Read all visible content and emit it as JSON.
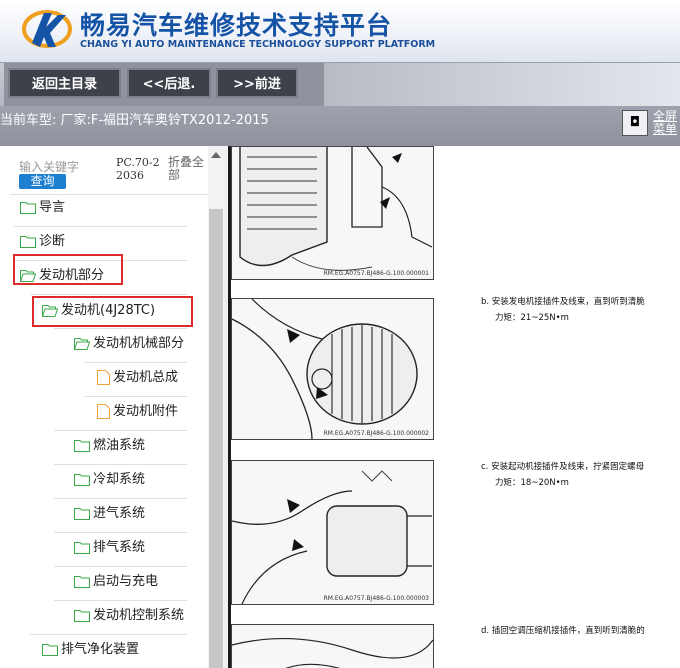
{
  "header": {
    "title_cn": "畅易汽车维修技术支持平台",
    "title_en": "CHANG YI AUTO MAINTENANCE TECHNOLOGY SUPPORT PLATFORM",
    "logo_icon": "cy-logo-icon"
  },
  "toolbar": {
    "home_label": "返回主目录",
    "back_label": "<<后退.",
    "forward_label": ">>前进"
  },
  "vehicle_bar": {
    "text": "当前车型:  厂家:F-福田汽车奥铃TX2012-2015",
    "fullscreen_label_1": "全屏",
    "fullscreen_label_2": "菜单",
    "fullscreen_icon": "fullscreen-icon"
  },
  "sidebar": {
    "search_placeholder": "输入关键字",
    "search_button": "查询",
    "model_code": "PC.70-22036",
    "collapse_label": "折叠全部",
    "items": [
      {
        "label": "导言",
        "icon": "folder-icon"
      },
      {
        "label": "诊断",
        "icon": "folder-icon"
      },
      {
        "label": "发动机部分",
        "icon": "folder-open-icon",
        "highlighted": true
      },
      {
        "label": "发动机(4J28TC)",
        "icon": "folder-open-icon",
        "highlighted": true
      },
      {
        "label": "发动机机械部分",
        "icon": "folder-open-icon"
      },
      {
        "label": "发动机总成",
        "icon": "file-icon"
      },
      {
        "label": "发动机附件",
        "icon": "file-icon"
      },
      {
        "label": "燃油系统",
        "icon": "folder-icon"
      },
      {
        "label": "冷却系统",
        "icon": "folder-icon"
      },
      {
        "label": "进气系统",
        "icon": "folder-icon"
      },
      {
        "label": "排气系统",
        "icon": "folder-icon"
      },
      {
        "label": "启动与充电",
        "icon": "folder-icon"
      },
      {
        "label": "发动机控制系统",
        "icon": "folder-icon"
      },
      {
        "label": "排气净化装置",
        "icon": "folder-icon"
      }
    ]
  },
  "content": {
    "figures": [
      {
        "caption": "RM.EG.A0757.BJ486-G.100.000001"
      },
      {
        "caption": "RM.EG.A0757.BJ486-G.100.000002"
      },
      {
        "caption": "RM.EG.A0757.BJ486-G.100.000003"
      }
    ],
    "steps": [
      {
        "text": "b. 安装发电机接插件及线束，直到听到清脆",
        "torque": "力矩：21~25N•m"
      },
      {
        "text": "c. 安装起动机接插件及线束，拧紧固定螺母",
        "torque": "力矩：18~20N•m"
      },
      {
        "text": "d. 插回空调压缩机接插件，直到听到清脆的",
        "torque": ""
      }
    ]
  },
  "colors": {
    "brand_blue": "#1553a6",
    "toolbar_button": "#3d4149",
    "highlight_red": "#dd2a2a",
    "folder_green": "#3aa84a",
    "file_orange": "#f0a038"
  }
}
